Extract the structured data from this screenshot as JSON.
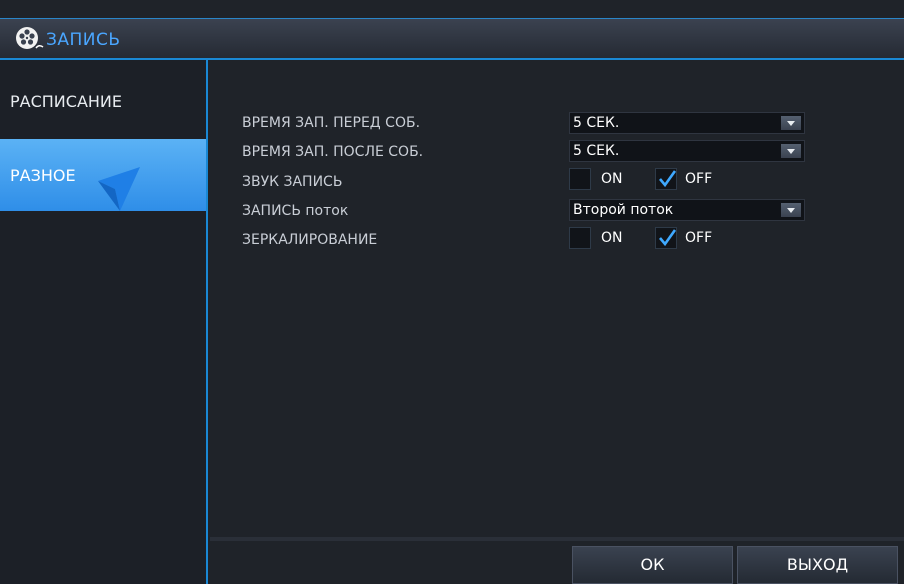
{
  "window": {
    "title": "ЗАПИСЬ",
    "title_icon": "film-reel-icon",
    "accent_color": "#1a88d4"
  },
  "sidebar": {
    "items": [
      {
        "label": "РАСПИСАНИЕ",
        "active": false
      },
      {
        "label": "РАЗНОЕ",
        "active": true
      }
    ]
  },
  "settings": {
    "pre_record": {
      "label": "ВРЕМЯ ЗАП. ПЕРЕД СОБ.",
      "value": "5 СЕК."
    },
    "post_record": {
      "label": "ВРЕМЯ ЗАП. ПОСЛЕ СОБ.",
      "value": "5 СЕК."
    },
    "audio_record": {
      "label": "ЗВУК ЗАПИСЬ",
      "on_label": "ON",
      "off_label": "OFF",
      "on_checked": false,
      "off_checked": true
    },
    "record_stream": {
      "label": "ЗАПИСЬ поток",
      "value": "Второй поток"
    },
    "mirroring": {
      "label": "ЗЕРКАЛИРОВАНИЕ",
      "on_label": "ON",
      "off_label": "OFF",
      "on_checked": false,
      "off_checked": true
    }
  },
  "footer": {
    "ok_label": "ОК",
    "exit_label": "ВЫХОД"
  }
}
